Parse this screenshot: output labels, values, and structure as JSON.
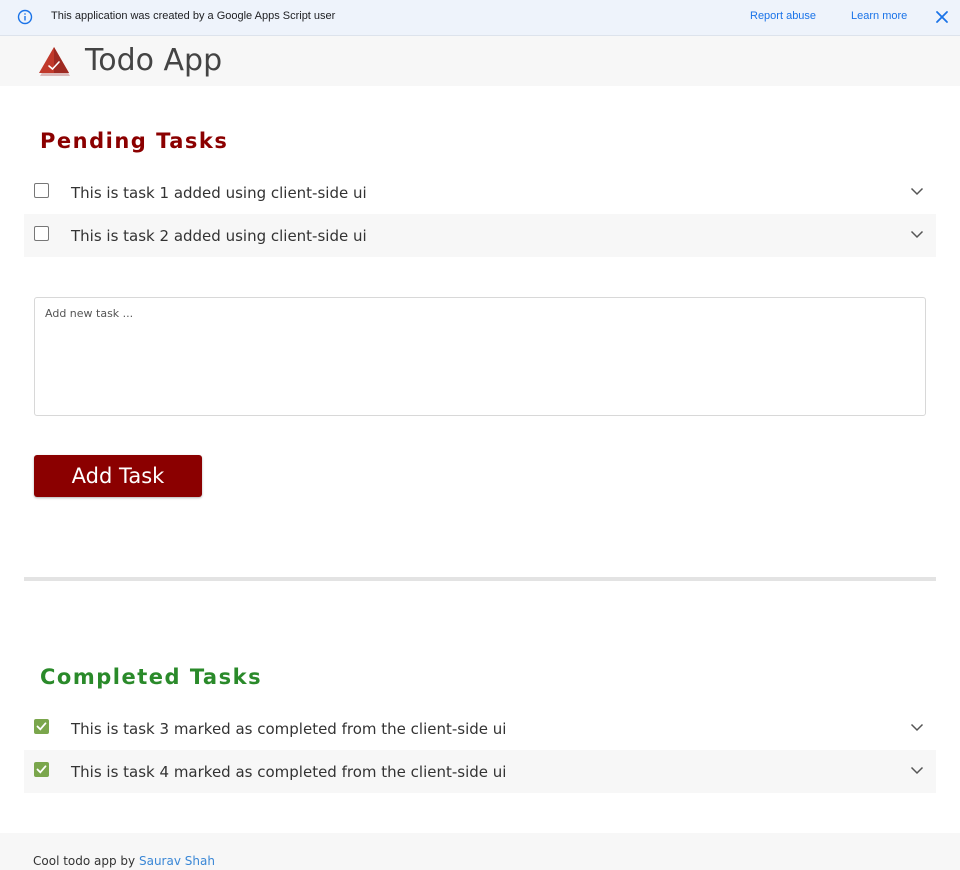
{
  "banner": {
    "message": "This application was created by a Google Apps Script user",
    "report_label": "Report abuse",
    "learn_label": "Learn more"
  },
  "app": {
    "title": "Todo App"
  },
  "pending": {
    "title": "Pending Tasks",
    "tasks": [
      {
        "text": "This is task 1 added using client-side ui",
        "done": false
      },
      {
        "text": "This is task 2 added using client-side ui",
        "done": false
      }
    ]
  },
  "new_task": {
    "placeholder": "Add new task ...",
    "value": "",
    "button_label": "Add Task"
  },
  "completed": {
    "title": "Completed Tasks",
    "tasks": [
      {
        "text": "This is task 3 marked as completed from the client-side ui",
        "done": true
      },
      {
        "text": "This is task 4 marked as completed from the client-side ui",
        "done": true
      }
    ]
  },
  "footer": {
    "prefix": "Cool todo app by ",
    "author": "Saurav Shah"
  },
  "colors": {
    "primary": "#8b0000",
    "pending_heading": "#8b0000",
    "completed_heading": "#2a8a2a",
    "checked": "#7aa64c",
    "link": "#3a87d6"
  },
  "icons": {
    "info": "info-icon",
    "close": "close-icon",
    "logo": "app-logo-icon",
    "chevron": "chevron-down-icon",
    "check": "checkmark-icon"
  }
}
